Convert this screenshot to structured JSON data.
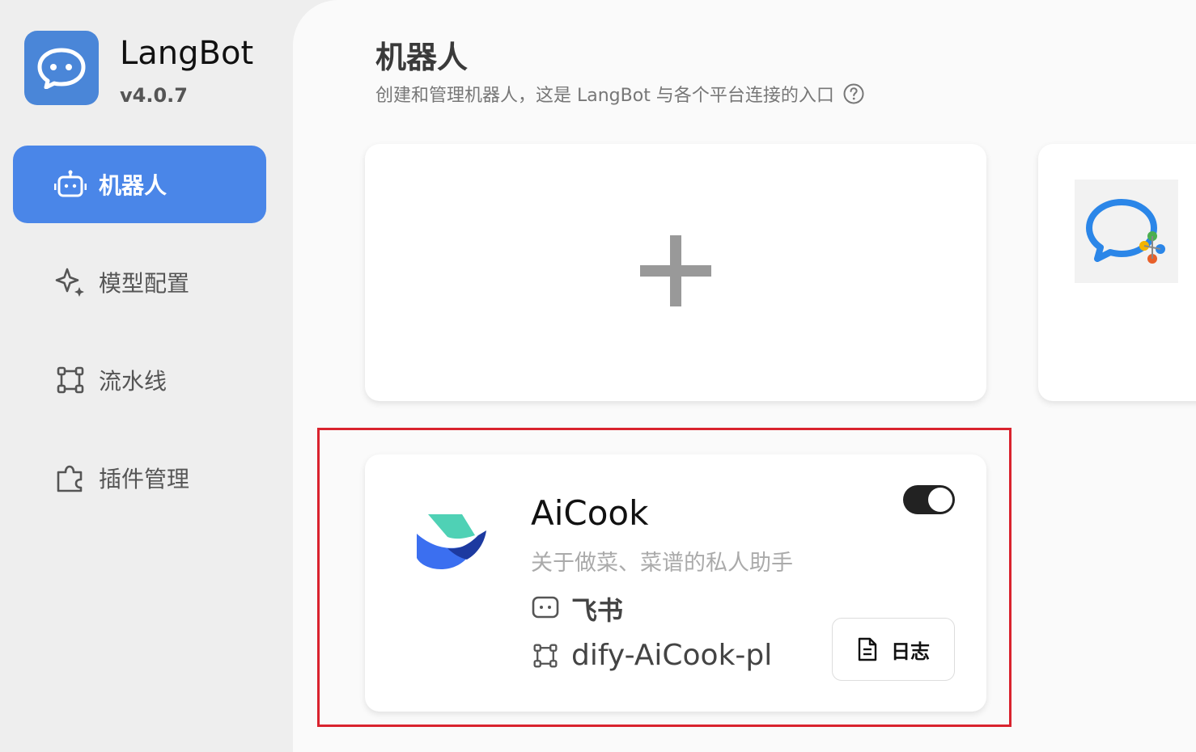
{
  "brand": {
    "name": "LangBot",
    "version": "v4.0.7"
  },
  "sidebar": {
    "items": [
      {
        "label": "机器人",
        "icon": "robot-icon",
        "active": true
      },
      {
        "label": "模型配置",
        "icon": "sparkle-icon",
        "active": false
      },
      {
        "label": "流水线",
        "icon": "pipeline-icon",
        "active": false
      },
      {
        "label": "插件管理",
        "icon": "puzzle-icon",
        "active": false
      }
    ]
  },
  "page": {
    "title": "机器人",
    "subtitle": "创建和管理机器人，这是 LangBot 与各个平台连接的入口",
    "help_icon": "question-circle-icon"
  },
  "add_card": {
    "icon": "plus-icon"
  },
  "side_card": {
    "icon": "wecom-chat-icon"
  },
  "bot": {
    "name": "AiCook",
    "description": "关于做菜、菜谱的私人助手",
    "platform": "飞书",
    "platform_icon": "chat-bubble-icon",
    "pipeline": "dify-AiCook-pl",
    "pipeline_icon": "pipeline-icon",
    "enabled": true,
    "log_button": "日志",
    "log_icon": "document-icon",
    "logo_icon": "feishu-logo"
  },
  "colors": {
    "accent": "#4a86e8",
    "highlight_border": "#d9232e",
    "toggle_on": "#222222"
  }
}
